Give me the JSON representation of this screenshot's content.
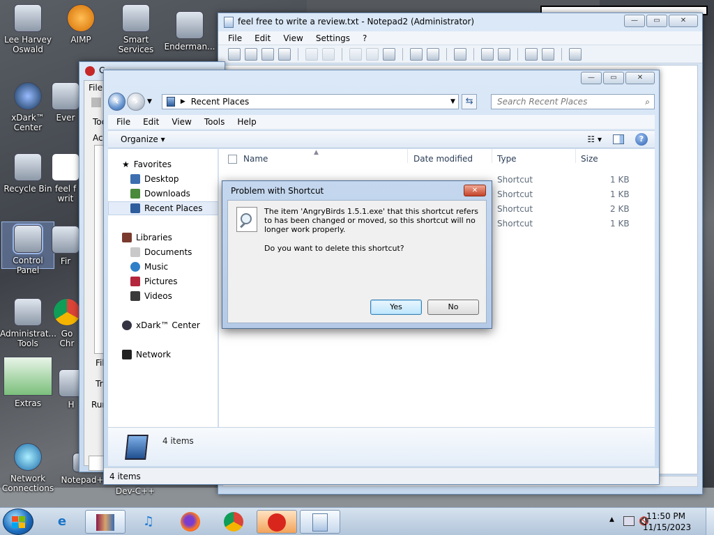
{
  "desktop": {
    "icons": [
      {
        "label": "Lee Harvey Oswald"
      },
      {
        "label": "AIMP"
      },
      {
        "label": "Smart Services"
      },
      {
        "label": "Enderman..."
      },
      {
        "label": "xDark™ Center"
      },
      {
        "label": "Ever"
      },
      {
        "label": "Recycle Bin"
      },
      {
        "label": "feel f writ"
      },
      {
        "label": "Control Panel"
      },
      {
        "label": "Fir"
      },
      {
        "label": "Administrat... Tools"
      },
      {
        "label": "Go Chr"
      },
      {
        "label": "Extras"
      },
      {
        "label": "H"
      },
      {
        "label": "Network Connections"
      },
      {
        "label": "Notepad+"
      },
      {
        "label": "Dev-C++"
      }
    ]
  },
  "notepad": {
    "title": "feel free to write a review.txt - Notepad2 (Administrator)",
    "menu": [
      "File",
      "Edit",
      "View",
      "Settings",
      "?"
    ]
  },
  "bgapp": {
    "title": "C",
    "labels": [
      "File",
      "Toc",
      "Act",
      "Fil",
      "Tr",
      "Run"
    ]
  },
  "explorer": {
    "address": "Recent Places",
    "search_placeholder": "Search Recent Places",
    "menu": [
      "File",
      "Edit",
      "View",
      "Tools",
      "Help"
    ],
    "organize": "Organize",
    "nav": {
      "favorites": "Favorites",
      "desktop": "Desktop",
      "downloads": "Downloads",
      "recent_places": "Recent Places",
      "libraries": "Libraries",
      "documents": "Documents",
      "music": "Music",
      "pictures": "Pictures",
      "videos": "Videos",
      "xdark": "xDark™ Center",
      "network": "Network"
    },
    "columns": {
      "name": "Name",
      "date": "Date modified",
      "type": "Type",
      "size": "Size"
    },
    "rows": [
      {
        "type": "Shortcut",
        "size": "1 KB"
      },
      {
        "type": "Shortcut",
        "size": "1 KB"
      },
      {
        "type": "Shortcut",
        "size": "2 KB"
      },
      {
        "type": "Shortcut",
        "size": "1 KB"
      }
    ],
    "details_count": "4 items",
    "status": "4 items"
  },
  "dialog": {
    "title": "Problem with Shortcut",
    "message": "The item 'AngryBirds 1.5.1.exe' that this shortcut refers to has been changed or moved, so this shortcut will no longer work properly.",
    "question": "Do you want to delete this shortcut?",
    "yes": "Yes",
    "no": "No"
  },
  "taskbar": {
    "time": "11:50 PM",
    "date": "11/15/2023"
  },
  "colors": {
    "accent": "#3c7fb1",
    "close_red": "#c4432a"
  }
}
